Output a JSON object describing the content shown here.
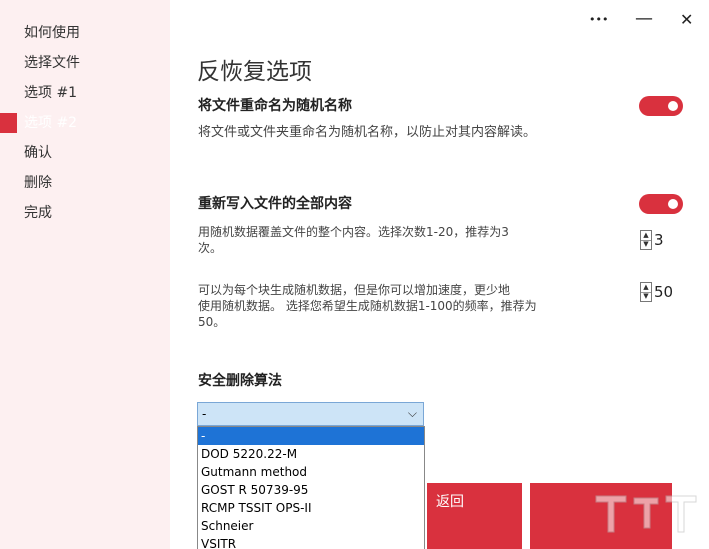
{
  "sidebar": {
    "items": [
      {
        "label": "如何使用"
      },
      {
        "label": "选择文件"
      },
      {
        "label": "选项 #1"
      },
      {
        "label": "选项 #2"
      },
      {
        "label": "确认"
      },
      {
        "label": "删除"
      },
      {
        "label": "完成"
      }
    ],
    "active_index": 3
  },
  "window": {
    "more_label": "•••",
    "close_label": "✕"
  },
  "main": {
    "title": "反恢复选项",
    "rename": {
      "heading": "将文件重命名为随机名称",
      "description": "将文件或文件夹重命名为随机名称，以防止对其内容解读。",
      "enabled": true
    },
    "rewrite": {
      "heading": "重新写入文件的全部内容",
      "enabled": true,
      "passes_description_line1": "用随机数据覆盖文件的整个内容。选择次数1-20，推荐为3",
      "passes_description_line2": "次。",
      "passes_value": "3",
      "frequency_description_line1": "可以为每个块生成随机数据，但是你可以增加速度，更少地",
      "frequency_description_line2": "使用随机数据。 选择您希望生成随机数据1-100的频率，推荐为",
      "frequency_description_line3": "50。",
      "frequency_value": "50"
    },
    "algorithm": {
      "heading": "安全删除算法",
      "selected": "-",
      "options": [
        "-",
        "DOD 5220.22-M",
        "Gutmann method",
        "GOST R 50739-95",
        "RCMP TSSIT OPS-II",
        "Schneier",
        "VSITR"
      ]
    },
    "back_button_label": "返回"
  },
  "colors": {
    "accent": "#d9313e",
    "sidebar_bg": "#fdf0f1",
    "select_highlight": "#1e73d6"
  },
  "icons": {
    "more": "more-dots-icon",
    "close": "close-icon",
    "chevron": "chevron-down-icon"
  }
}
